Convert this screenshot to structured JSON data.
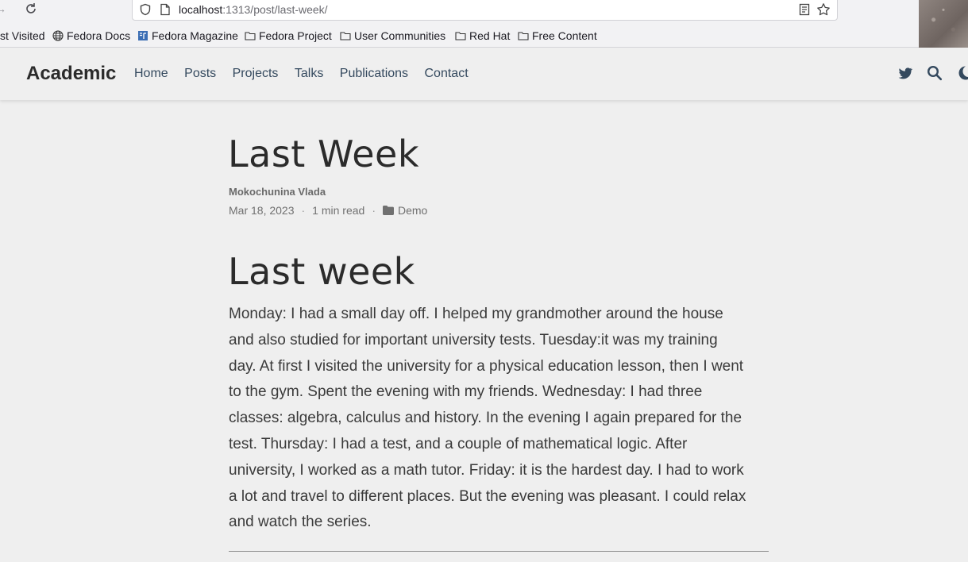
{
  "browser": {
    "url_host": "localhost",
    "url_path": ":1313/post/last-week/",
    "bookmarks": [
      {
        "label": "st Visited",
        "icon": "none"
      },
      {
        "label": "Fedora Docs",
        "icon": "globe-icon"
      },
      {
        "label": "Fedora Magazine",
        "icon": "fedora-magazine-icon"
      },
      {
        "label": "Fedora Project",
        "icon": "folder-icon"
      },
      {
        "label": "User Communities",
        "icon": "folder-icon"
      },
      {
        "label": "Red Hat",
        "icon": "folder-icon"
      },
      {
        "label": "Free Content",
        "icon": "folder-icon"
      }
    ]
  },
  "site": {
    "brand": "Academic",
    "nav": [
      "Home",
      "Posts",
      "Projects",
      "Talks",
      "Publications",
      "Contact"
    ],
    "icons": [
      "twitter-icon",
      "search-icon",
      "moon-icon"
    ],
    "link_color": "#34495e"
  },
  "article": {
    "title": "Last Week",
    "author": "Mokochunina Vlada",
    "date": "Mar 18, 2023",
    "read_time": "1 min read",
    "category": "Demo",
    "heading": "Last week",
    "lines": [
      "Monday: I had a small day off. I helped my grandmother around the house",
      "and also studied for important university tests. Tuesday:it was my training",
      "day. At first I visited the university for a physical education lesson, then I went",
      "to the gym. Spent the evening with my friends. Wednesday: I had three",
      "classes: algebra, calculus and history. In the evening I again prepared for the",
      "test. Thursday: I had a test, and a couple of mathematical logic. After",
      "university, I worked as a math tutor. Friday: it is the hardest day. I had to work",
      "a lot and travel to different places. But the evening was pleasant. I could relax",
      "and watch the series."
    ]
  }
}
